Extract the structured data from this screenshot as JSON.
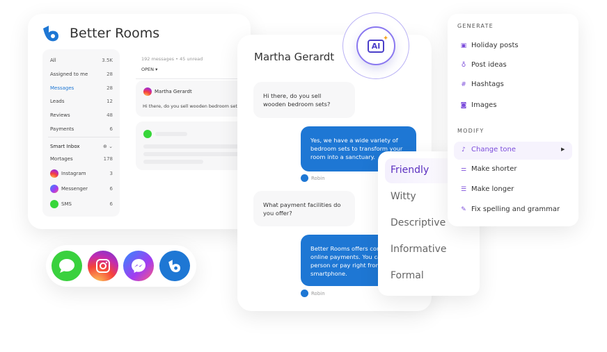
{
  "app": {
    "title": "Better Rooms"
  },
  "sidebar": {
    "items": [
      {
        "label": "All",
        "count": "3.5K"
      },
      {
        "label": "Assigned to me",
        "count": "28"
      },
      {
        "label": "Messages",
        "count": "28",
        "active": true
      },
      {
        "label": "Leads",
        "count": "12"
      },
      {
        "label": "Reviews",
        "count": "48"
      },
      {
        "label": "Payments",
        "count": "6"
      }
    ],
    "smart_inbox": {
      "label": "Smart Inbox",
      "items": [
        {
          "label": "Mortages",
          "count": "178"
        },
        {
          "label": "Instagram",
          "count": "3",
          "icon": "instagram-icon"
        },
        {
          "label": "Messenger",
          "count": "6",
          "icon": "messenger-icon"
        },
        {
          "label": "SMS",
          "count": "6",
          "icon": "sms-icon"
        }
      ]
    }
  },
  "list": {
    "summary": "192 messages • 45 unread",
    "filter": "OPEN",
    "items": [
      {
        "name": "Martha Gerardt",
        "preview": "Hi there, do you sell wooden bedroom sets?"
      }
    ]
  },
  "chat": {
    "title": "Martha Gerardt",
    "ai_badge": "AI",
    "messages": [
      {
        "from": "customer",
        "text": "Hi there, do you sell wooden bedroom sets?"
      },
      {
        "from": "agent",
        "text": "Yes, we have a wide variety of bedroom sets to transform your room into a sanctuary.",
        "author": "Robin"
      },
      {
        "from": "customer",
        "text": "What payment facilities do you offer?"
      },
      {
        "from": "agent",
        "text": "Better Rooms offers con online payments. You ca person or pay right from smartphone.",
        "author": "Robin"
      }
    ]
  },
  "tones": [
    "Friendly",
    "Witty",
    "Descriptive",
    "Informative",
    "Formal"
  ],
  "ai_menu": {
    "generate_label": "GENERATE",
    "generate": [
      "Holiday posts",
      "Post ideas",
      "Hashtags",
      "Images"
    ],
    "modify_label": "MODIFY",
    "modify": [
      "Change tone",
      "Make shorter",
      "Make longer",
      "Fix spelling and grammar"
    ]
  },
  "colors": {
    "brand": "#1e77d4",
    "accent": "#7c4ddb"
  }
}
